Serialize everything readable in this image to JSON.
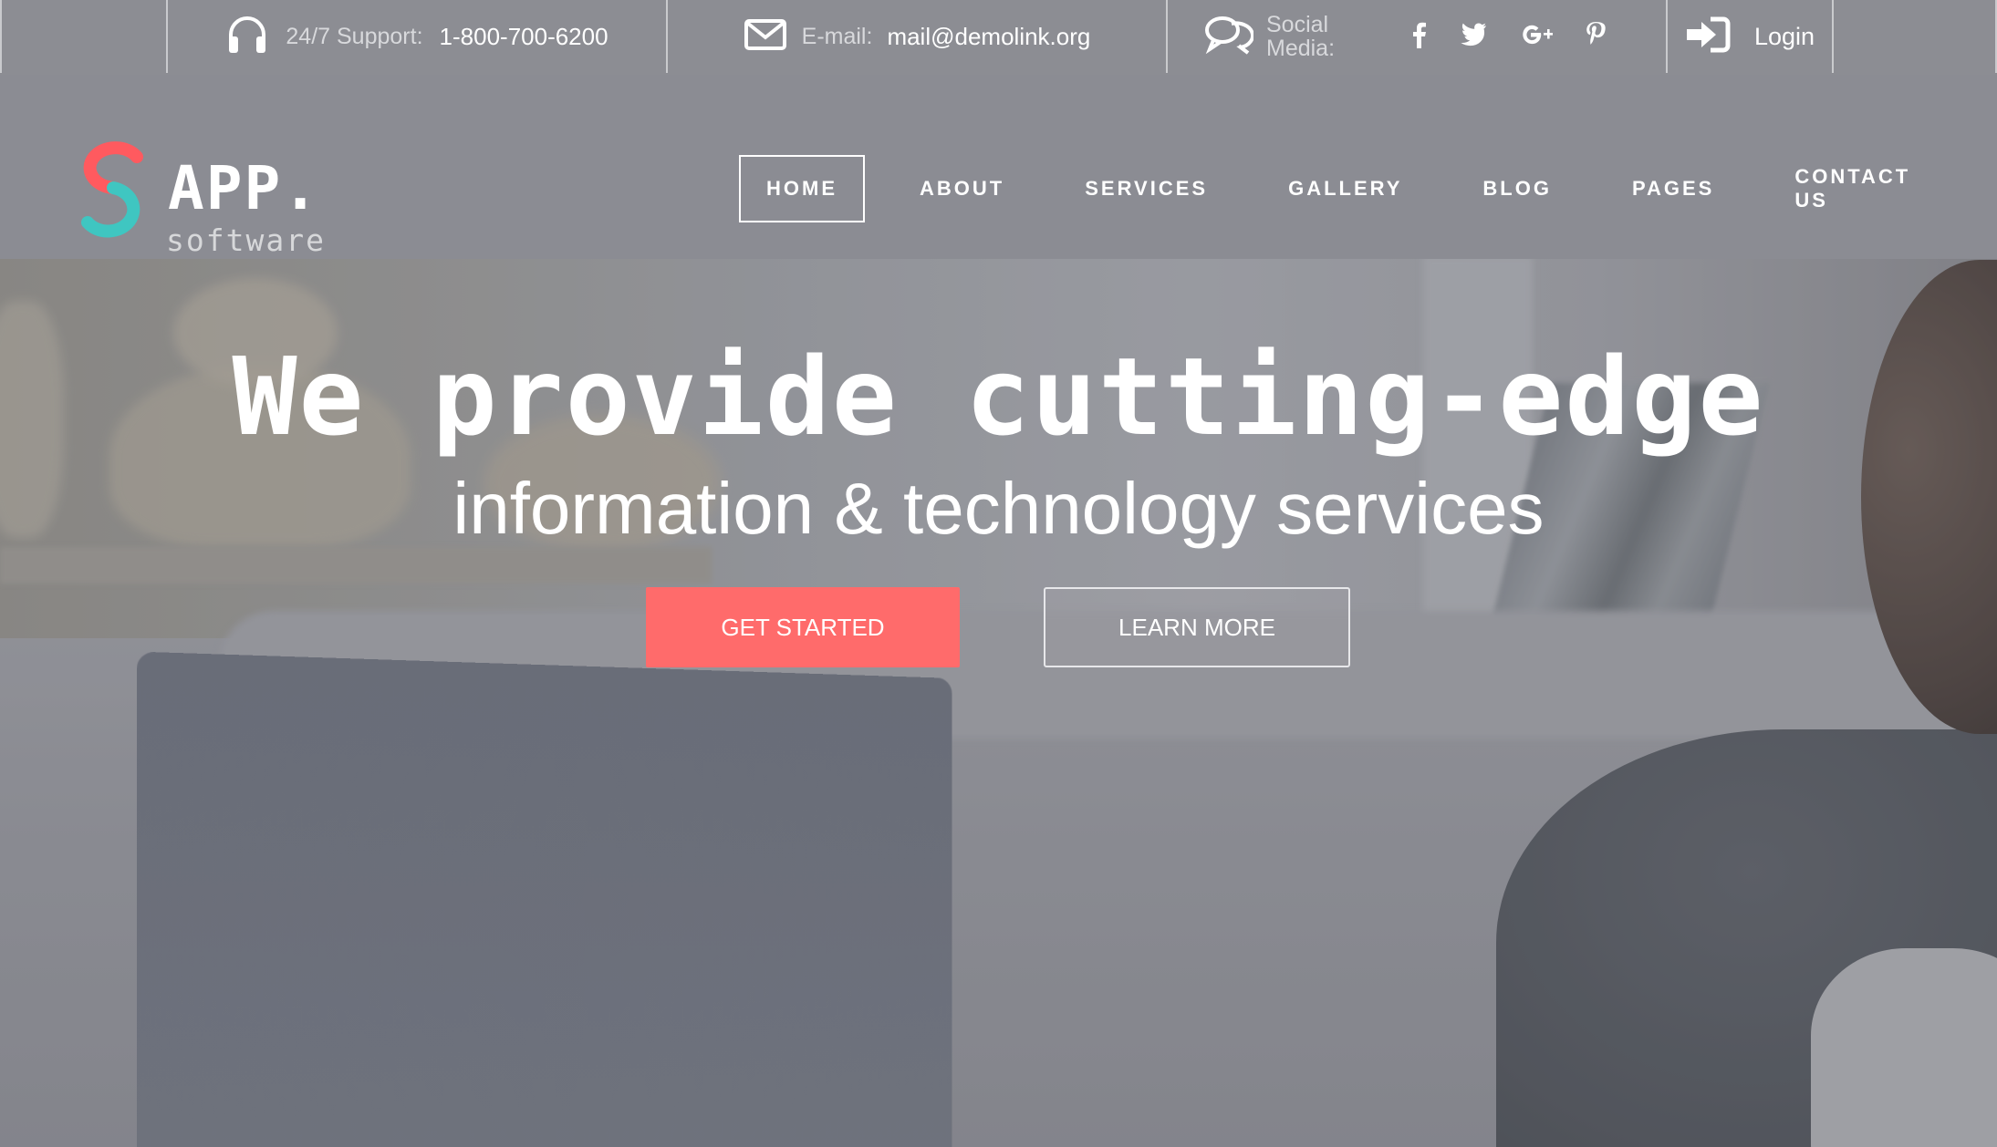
{
  "topbar": {
    "support": {
      "icon": "headphones-icon",
      "label": "24/7 Support:",
      "value": "1-800-700-6200"
    },
    "email": {
      "icon": "envelope-icon",
      "label": "E-mail:",
      "value": "mail@demolink.org"
    },
    "social": {
      "icon": "chat-bubbles-icon",
      "label": "Social Media:",
      "icons": [
        {
          "name": "facebook-icon",
          "glyph": "f"
        },
        {
          "name": "twitter-icon",
          "glyph": "🐦"
        },
        {
          "name": "google-plus-icon",
          "glyph": "G+"
        },
        {
          "name": "pinterest-icon",
          "glyph": "p"
        }
      ]
    },
    "login": {
      "icon": "login-icon",
      "label": "Login"
    }
  },
  "logo": {
    "title": "APP.",
    "subtitle": "software"
  },
  "nav": {
    "items": [
      {
        "label": "HOME",
        "active": true
      },
      {
        "label": "ABOUT"
      },
      {
        "label": "SERVICES"
      },
      {
        "label": "GALLERY"
      },
      {
        "label": "BLOG"
      },
      {
        "label": "PAGES"
      },
      {
        "label": "CONTACT US"
      }
    ]
  },
  "hero": {
    "title": "We provide cutting-edge",
    "subtitle": "information & technology services",
    "primary_button": "GET STARTED",
    "secondary_button": "LEARN MORE"
  },
  "colors": {
    "accent": "#ff6b6b",
    "logo_red": "#ff5a5f",
    "logo_teal": "#3fc6c1",
    "overlay": "#8b8c93"
  }
}
